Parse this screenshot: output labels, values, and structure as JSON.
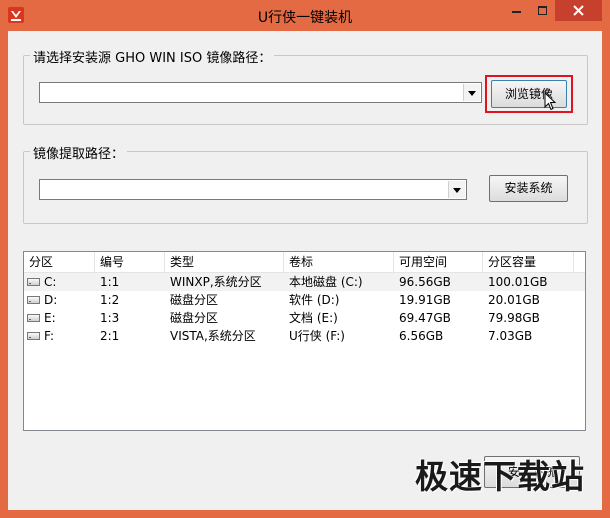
{
  "window": {
    "title": "U行侠一键装机",
    "title_bar_color": "#e46a43",
    "close_button_color": "#c7402d"
  },
  "source_group": {
    "label": "请选择安装源 GHO WIN ISO 镜像路径：",
    "combo_value": "",
    "browse_button": "浏览镜像"
  },
  "extract_group": {
    "label": "镜像提取路径：",
    "combo_value": "",
    "install_button": "安装系统"
  },
  "partition_table": {
    "columns": [
      "分区",
      "编号",
      "类型",
      "卷标",
      "可用空间",
      "分区容量"
    ],
    "rows": [
      {
        "partition": "C:",
        "number": "1:1",
        "type": "WINXP,系统分区",
        "label": "本地磁盘 (C:)",
        "free": "96.56GB",
        "capacity": "100.01GB"
      },
      {
        "partition": "D:",
        "number": "1:2",
        "type": "磁盘分区",
        "label": "软件 (D:)",
        "free": "19.91GB",
        "capacity": "20.01GB"
      },
      {
        "partition": "E:",
        "number": "1:3",
        "type": "磁盘分区",
        "label": "文档 (E:)",
        "free": "69.47GB",
        "capacity": "79.98GB"
      },
      {
        "partition": "F:",
        "number": "2:1",
        "type": "VISTA,系统分区",
        "label": "U行侠 (F:)",
        "free": "6.56GB",
        "capacity": "7.03GB"
      }
    ]
  },
  "bottom": {
    "button_label": "安装系统"
  },
  "watermark": {
    "text": "极速下载站"
  },
  "highlight_color": "#e0141e"
}
